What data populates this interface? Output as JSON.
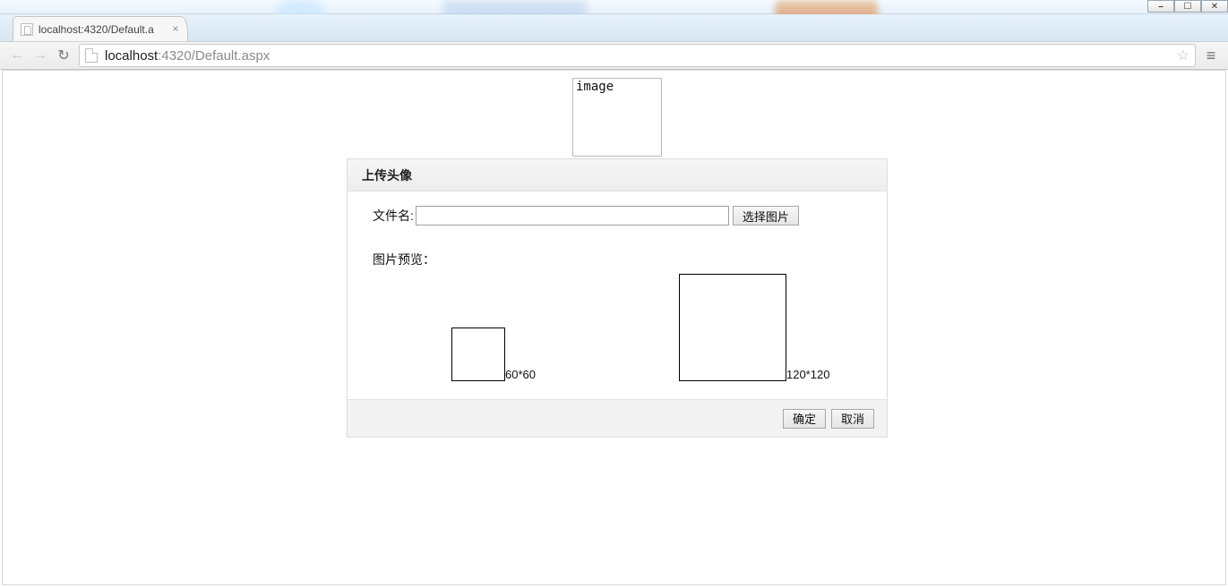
{
  "window": {
    "minimize_glyph": "⎯",
    "maximize_glyph": "☐",
    "close_glyph": "✕"
  },
  "browser": {
    "tab_title": "localhost:4320/Default.a",
    "tab_close_glyph": "×",
    "back_glyph": "←",
    "forward_glyph": "→",
    "reload_glyph": "↻",
    "url_host": "localhost",
    "url_rest": ":4320/Default.aspx",
    "star_glyph": "☆",
    "menu_glyph": "≡"
  },
  "page": {
    "placeholder_text": "image"
  },
  "dialog": {
    "title": "上传头像",
    "filename_label": "文件名:",
    "filename_value": "",
    "choose_button": "选择图片",
    "preview_label": "图片预览：",
    "preview_60_caption": "60*60",
    "preview_120_caption": "120*120",
    "ok_button": "确定",
    "cancel_button": "取消"
  }
}
